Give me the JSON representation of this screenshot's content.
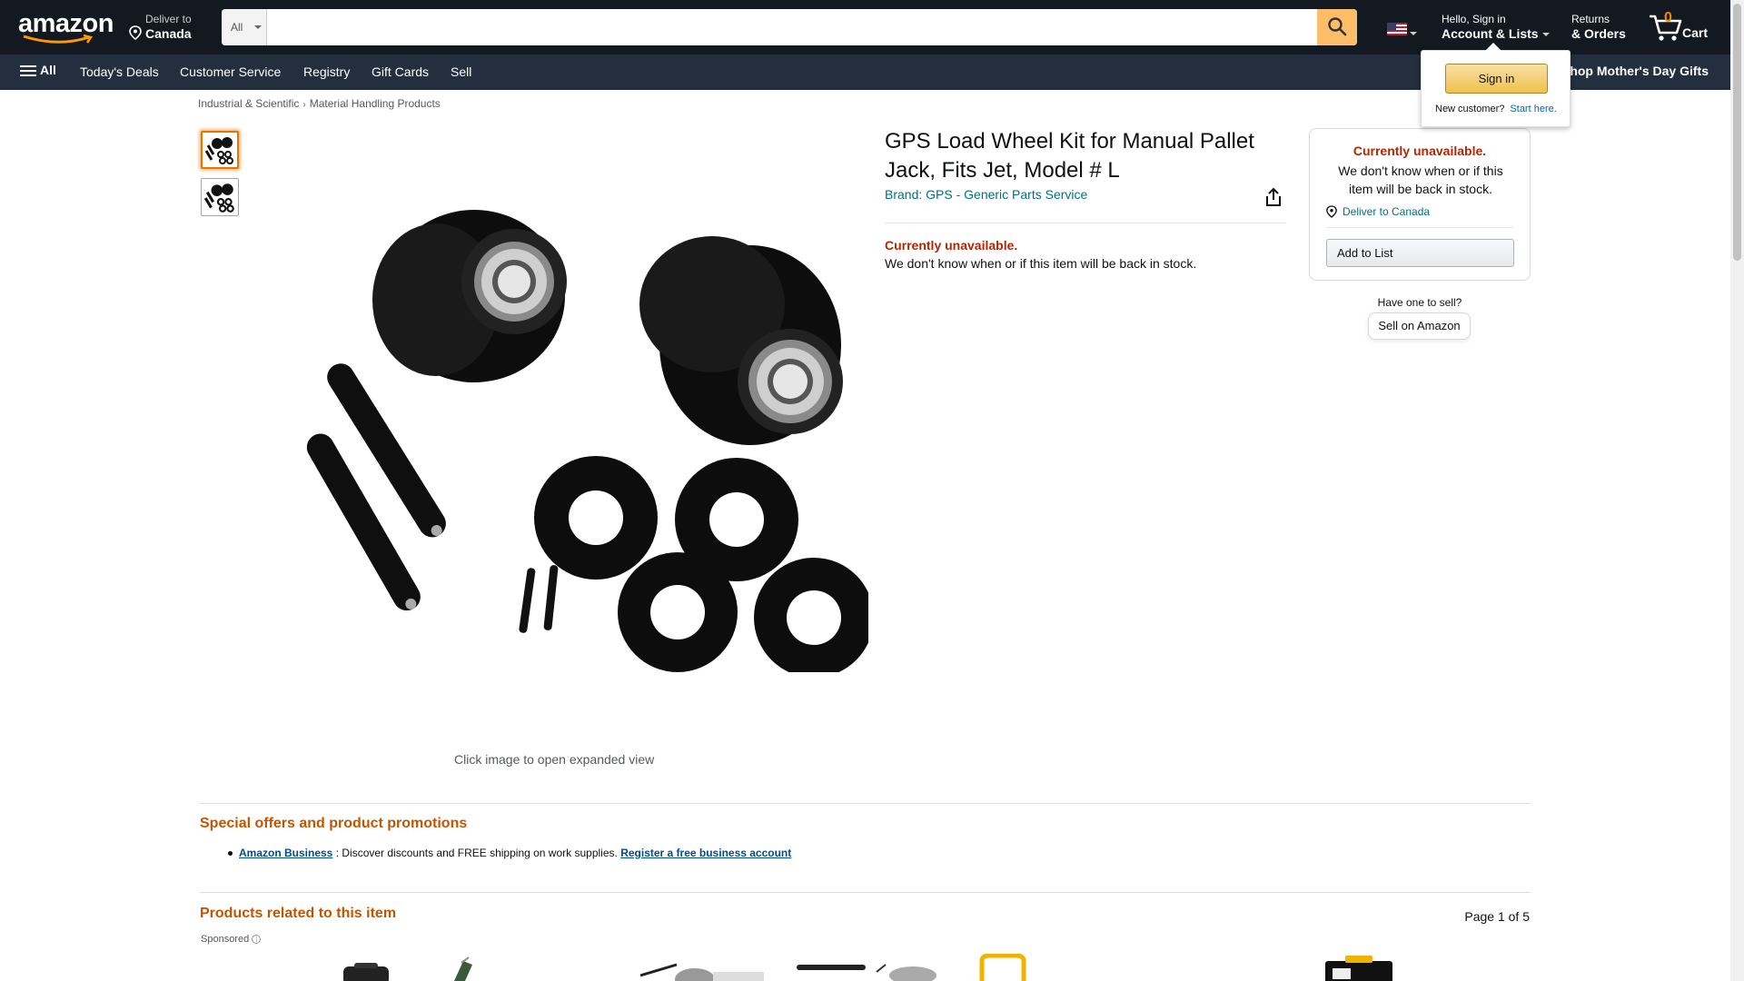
{
  "header": {
    "logo_text": "amazon",
    "deliver_line1": "Deliver to",
    "deliver_line2": "Canada",
    "search_category": "All",
    "search_placeholder": "",
    "account_line1": "Hello, Sign in",
    "account_line2": "Account & Lists",
    "returns_line1": "Returns",
    "returns_line2": "& Orders",
    "cart_count": "0",
    "cart_label": "Cart"
  },
  "subnav": {
    "all_label": "All",
    "items": [
      "Today's Deals",
      "Customer Service",
      "Registry",
      "Gift Cards",
      "Sell"
    ],
    "promo": "Shop Mother's Day Gifts"
  },
  "flyout": {
    "signin_label": "Sign in",
    "new_customer": "New customer?",
    "start_here": "Start here."
  },
  "breadcrumb": [
    "Industrial & Scientific",
    "Material Handling Products"
  ],
  "product": {
    "title": "GPS Load Wheel Kit for Manual Pallet Jack, Fits Jet, Model # L",
    "brand": "Brand: GPS - Generic Parts Service",
    "availability": "Currently unavailable.",
    "availability_msg": "We don't know when or if this item will be back in stock.",
    "expand_hint": "Click image to open expanded view"
  },
  "buybox": {
    "availability": "Currently unavailable.",
    "message": "We don't know when or if this item will be back in stock.",
    "deliver": "Deliver to Canada",
    "add_to_list": "Add to List",
    "have_one": "Have one to sell?",
    "sell_label": "Sell on Amazon"
  },
  "promotions": {
    "heading": "Special offers and product promotions",
    "link1": "Amazon Business",
    "text": " : Discover discounts and FREE shipping on work supplies. ",
    "link2": "Register a free business account"
  },
  "related": {
    "heading": "Products related to this item",
    "page": "Page 1 of 5",
    "sponsored": "Sponsored"
  },
  "colors": {
    "nav_dark": "#131921",
    "nav_sub": "#232f3e",
    "accent": "#febd69",
    "link": "#007185",
    "alert": "#b12704",
    "heading_orange": "#c45500"
  }
}
